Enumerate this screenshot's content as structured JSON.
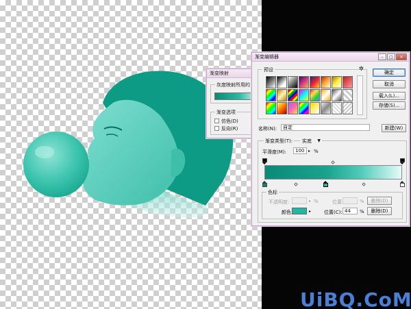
{
  "colors": {
    "teal_dark": "#0a8a76",
    "teal_mid": "#2bb8a3",
    "teal_light": "#e6fbf8",
    "dialog_border": "#c8a0c8",
    "watermark": "#4a7fd6"
  },
  "gradient_map": {
    "title": "渐变映射",
    "group_label": "灰度映射所用的",
    "options_label": "渐变选项",
    "dither_label": "仿色(D)",
    "reverse_label": "反向(R)"
  },
  "gradient_editor": {
    "title": "渐变编辑器",
    "presets_label": "预设",
    "ok_label": "确定",
    "cancel_label": "取消",
    "load_label": "载入(L)...",
    "save_label": "存储(S)...",
    "name_label": "名称(N):",
    "name_value": "自定",
    "new_label": "新建(W)",
    "type_label": "渐变类型(T):",
    "type_value": "实底",
    "smooth_label": "平滑度(M):",
    "smooth_value": "100",
    "percent": "%",
    "stops_label": "色标",
    "opacity_label": "不透明度:",
    "location_label": "位置:",
    "location2_label": "位置(C):",
    "location_value": "44",
    "delete_label": "删除(D)",
    "color_label": "颜色:",
    "stop_color": "#1fb8a4"
  },
  "watermark": "UiBQ.CoM"
}
